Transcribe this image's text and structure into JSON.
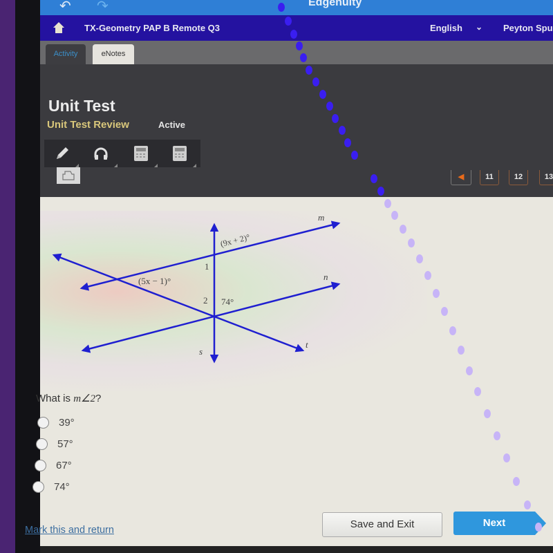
{
  "app": {
    "brand": "Edgenuity",
    "undo_icon": "undo-arrow-icon",
    "redo_icon": "redo-arrow-icon"
  },
  "navbar": {
    "home_icon": "home-icon",
    "course": "TX-Geometry PAP B Remote Q3",
    "language": "English",
    "language_chevron": "⌄",
    "user": "Peyton Spu"
  },
  "tabs": [
    {
      "label": "Activity",
      "active": true
    },
    {
      "label": "eNotes",
      "active": false
    }
  ],
  "header": {
    "title": "Unit Test",
    "subtitle": "Unit Test Review",
    "status": "Active"
  },
  "toolbar": {
    "tools": [
      "pencil-icon",
      "headphones-icon",
      "calculator-icon",
      "calculator-icon"
    ],
    "print_icon": "print-icon"
  },
  "pager": {
    "prev_symbol": "◀",
    "pages": [
      "11",
      "12",
      "13"
    ]
  },
  "diagram": {
    "line_labels": {
      "m": "m",
      "n": "n",
      "s": "s",
      "t": "t"
    },
    "angle_labels": {
      "top": "(9x + 2)°",
      "left": "(5x − 1)°",
      "angle1": "1",
      "angle2": "2",
      "given": "74°"
    },
    "line_color": "#1f1fd0"
  },
  "question": {
    "prefix": "What is ",
    "math": "m∠2",
    "suffix": "?",
    "options": [
      "39°",
      "57°",
      "67°",
      "74°"
    ]
  },
  "footer": {
    "mark_link": "Mark this and return",
    "save_button": "Save and Exit",
    "next_button": "Next"
  }
}
